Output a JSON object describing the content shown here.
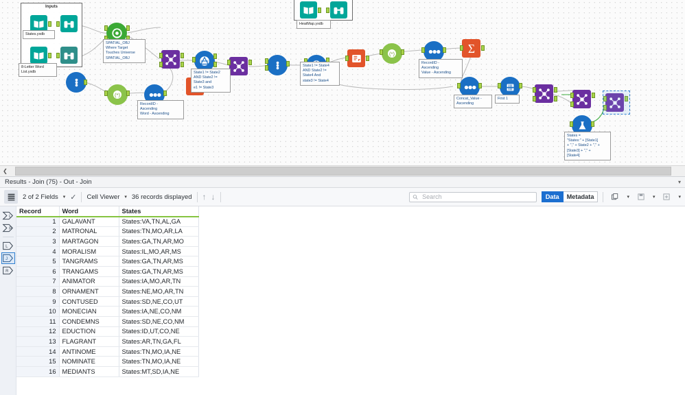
{
  "canvas": {
    "containers": [
      {
        "title": "Inputs"
      }
    ],
    "annotations": [
      {
        "id": "states_db",
        "text": "States.yxdb"
      },
      {
        "id": "word_list",
        "text": "8-Letter Word\nList.yxdb"
      },
      {
        "id": "heatmap_db",
        "text": "HeatMap.yxdb"
      },
      {
        "id": "spatial",
        "text": "SPATIAL_OBJ\nWhere Target\nTouches Universe\nSPATIAL_OBJ"
      },
      {
        "id": "filter1",
        "text": "State1 != State2\nAND State2 !=\nState3 and\ne1 != State3"
      },
      {
        "id": "sort1",
        "text": "RecordID -\nAscending\nWord - Ascending"
      },
      {
        "id": "filter2",
        "text": "State1 != State4\nAND State2 !=\nState4 And\nstate3 != State4"
      },
      {
        "id": "sort2",
        "text": "RecordID -\nAscending\nValue - Ascending"
      },
      {
        "id": "sort3",
        "text": "Concat_Value -\nAscending"
      },
      {
        "id": "sample",
        "text": "First 1"
      },
      {
        "id": "formula",
        "text": "States =\n\"States:\" + [State1]\n+ \",\" + State2 + \",\" +\n[State3] + \",\" +\n[State4]"
      }
    ],
    "nodes": [
      {
        "id": "input-states",
        "icon": "book-icon",
        "color": "#00a699"
      },
      {
        "id": "browse-states",
        "icon": "binoculars-icon",
        "color": "#00a699"
      },
      {
        "id": "input-words",
        "icon": "book-icon",
        "color": "#00a699"
      },
      {
        "id": "browse-words",
        "icon": "binoculars-icon",
        "color": "#00a699"
      },
      {
        "id": "input-heatmap",
        "icon": "book-icon",
        "color": "#00a699"
      },
      {
        "id": "browse-heatmap",
        "icon": "binoculars-icon",
        "color": "#00a699"
      },
      {
        "id": "spatial-match",
        "icon": "spatial-match-icon",
        "color": "#3ba935"
      },
      {
        "id": "record-id-1",
        "icon": "record-id-icon",
        "color": "#1a6fc4"
      },
      {
        "id": "text-to-columns",
        "icon": "text-to-columns-icon",
        "color": "#8bc34a"
      },
      {
        "id": "sort-1",
        "icon": "sort-icon",
        "color": "#1a6fc4"
      },
      {
        "id": "append-fields",
        "icon": "append-icon",
        "color": "#1a6fc4"
      },
      {
        "id": "join-1",
        "icon": "join-icon",
        "color": "#6b2fa0"
      },
      {
        "id": "join-2",
        "icon": "join-icon",
        "color": "#6b2fa0"
      },
      {
        "id": "filter-1",
        "icon": "filter-icon",
        "color": "#1a6fc4"
      },
      {
        "id": "filter-2",
        "icon": "filter-icon",
        "color": "#1a6fc4"
      },
      {
        "id": "transpose-1",
        "icon": "transpose-icon",
        "color": "#e2542a"
      },
      {
        "id": "summarize-1",
        "icon": "summarize-icon",
        "color": "#e2542a"
      },
      {
        "id": "unique-1",
        "icon": "unique-icon",
        "color": "#8bc34a"
      },
      {
        "id": "sort-2",
        "icon": "sort-icon",
        "color": "#1a6fc4"
      },
      {
        "id": "sort-3",
        "icon": "sort-icon",
        "color": "#1a6fc4"
      },
      {
        "id": "sample-1",
        "icon": "sample-icon",
        "color": "#1a6fc4"
      },
      {
        "id": "join-3",
        "icon": "join-icon",
        "color": "#6b2fa0"
      },
      {
        "id": "join-4",
        "icon": "join-icon",
        "color": "#6b2fa0"
      },
      {
        "id": "join-5",
        "icon": "join-icon",
        "color": "#6b2fa0"
      },
      {
        "id": "formula-1",
        "icon": "formula-flask-icon",
        "color": "#1a6fc4"
      }
    ]
  },
  "results": {
    "title": "Results - Join (75) - Out - Join",
    "toolbar": {
      "fields_label": "2 of 2 Fields",
      "viewer_label": "Cell Viewer",
      "records_label": "36 records displayed"
    },
    "search": {
      "placeholder": "Search",
      "value": ""
    },
    "tabs": {
      "data": "Data",
      "metadata": "Metadata",
      "selected": "Data"
    },
    "anchors": [
      {
        "id": "anchor-left-in",
        "label": "L",
        "selected": false
      },
      {
        "id": "anchor-right-in",
        "label": "R",
        "selected": false
      },
      {
        "id": "anchor-left-out",
        "label": "L",
        "selected": false
      },
      {
        "id": "anchor-join-out",
        "label": "J",
        "selected": true
      },
      {
        "id": "anchor-right-out",
        "label": "R",
        "selected": false
      }
    ],
    "table": {
      "columns": [
        "Record",
        "Word",
        "States"
      ],
      "rows": [
        [
          "1",
          "GALAVANT",
          "States:VA,TN,AL,GA"
        ],
        [
          "2",
          "MATRONAL",
          "States:TN,MO,AR,LA"
        ],
        [
          "3",
          "MARTAGON",
          "States:GA,TN,AR,MO"
        ],
        [
          "4",
          "MORALISM",
          "States:IL,MO,AR,MS"
        ],
        [
          "5",
          "TANGRAMS",
          "States:GA,TN,AR,MS"
        ],
        [
          "6",
          "TRANGAMS",
          "States:GA,TN,AR,MS"
        ],
        [
          "7",
          "ANIMATOR",
          "States:IA,MO,AR,TN"
        ],
        [
          "8",
          "ORNAMENT",
          "States:NE,MO,AR,TN"
        ],
        [
          "9",
          "CONTUSED",
          "States:SD,NE,CO,UT"
        ],
        [
          "10",
          "MONECIAN",
          "States:IA,NE,CO,NM"
        ],
        [
          "11",
          "CONDEMNS",
          "States:SD,NE,CO,NM"
        ],
        [
          "12",
          "EDUCTION",
          "States:ID,UT,CO,NE"
        ],
        [
          "13",
          "FLAGRANT",
          "States:AR,TN,GA,FL"
        ],
        [
          "14",
          "ANTINOME",
          "States:TN,MO,IA,NE"
        ],
        [
          "15",
          "NOMINATE",
          "States:TN,MO,IA,NE"
        ],
        [
          "16",
          "MEDIANTS",
          "States:MT,SD,IA,NE"
        ]
      ]
    }
  }
}
